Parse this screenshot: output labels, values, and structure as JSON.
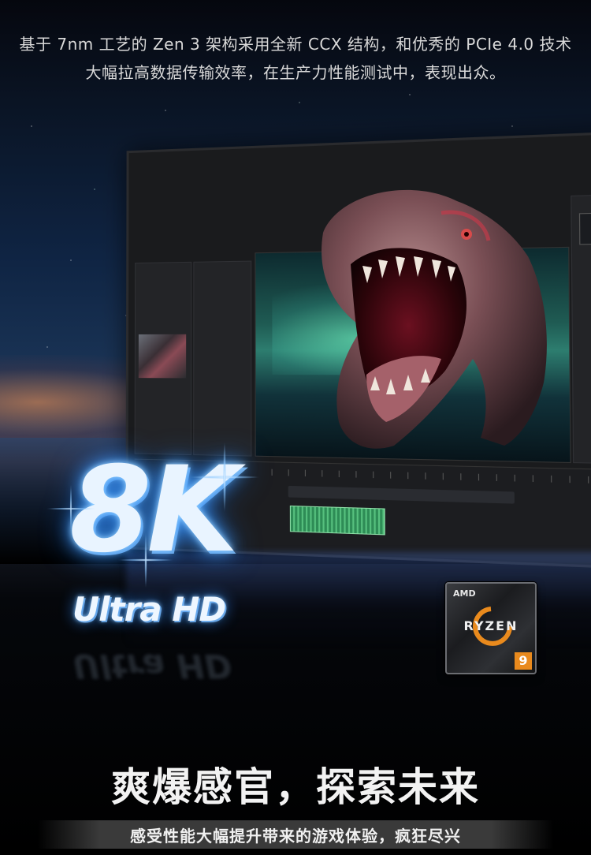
{
  "header": {
    "line1": "基于 7nm 工艺的 Zen 3 架构采用全新 CCX 结构，和优秀的 PCIe 4.0 技术",
    "line2": "大幅拉高数据传输效率，在生产力性能测试中，表现出众。"
  },
  "hero": {
    "resolution": "8K",
    "resolution_label": "Ultra HD"
  },
  "badge": {
    "brand": "AMD",
    "product": "RYZEN",
    "tier": "9",
    "accent_color": "#e98a1d"
  },
  "footer": {
    "slogan": "爽爆感官，探索未来",
    "subtitle": "感受性能大幅提升带来的游戏体验，疯狂尽兴"
  },
  "icons": {
    "monitor": "monitor-icon",
    "dinosaur": "dinosaur-illustration",
    "ryzen": "ryzen-logo-icon"
  }
}
